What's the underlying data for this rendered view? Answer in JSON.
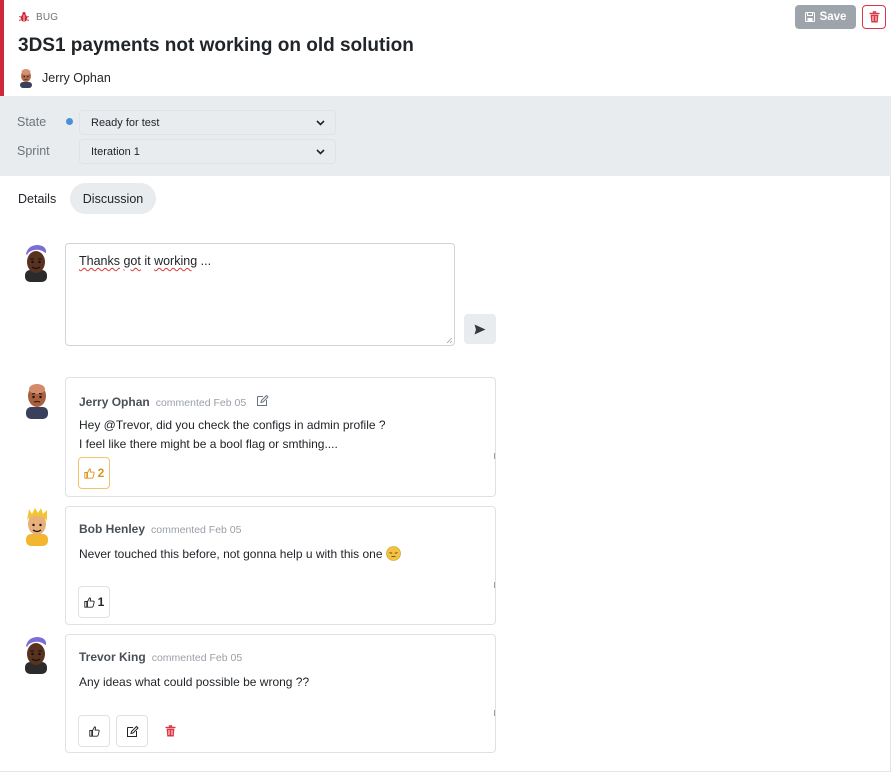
{
  "work_item": {
    "type_label": "BUG",
    "title": "3DS1 payments not working on old solution",
    "owner": "Jerry Ophan",
    "save_label": "Save"
  },
  "fields": {
    "state_label": "State",
    "state_value": "Ready for test",
    "sprint_label": "Sprint",
    "sprint_value": "Iteration 1"
  },
  "tabs": [
    {
      "label": "Details",
      "active": false
    },
    {
      "label": "Discussion",
      "active": true
    }
  ],
  "compose": {
    "text_parts": [
      "Thanks",
      " ",
      "got",
      " it ",
      "working",
      " ..."
    ]
  },
  "comments": [
    {
      "author": "Jerry Ophan",
      "meta": "commented Feb 05",
      "lines": [
        "Hey @Trevor, did you check the configs in admin profile ?",
        "I feel like there might be a bool flag or smthing...."
      ],
      "likes": "2"
    },
    {
      "author": "Bob Henley",
      "meta": "commented Feb 05",
      "lines": [
        "Never touched this before, not gonna help u with this one"
      ],
      "likes": "1"
    },
    {
      "author": "Trevor King",
      "meta": "commented Feb 05",
      "lines": [
        "Any ideas what could possible be wrong ??"
      ],
      "likes": ""
    }
  ],
  "colors": {
    "accent": "#cc293d",
    "state_dot": "#4a90d9",
    "like_active": "#d8941b",
    "delete": "#dc3545"
  },
  "icons": [
    "bug-icon",
    "save-icon",
    "trash-icon",
    "chevron-down-icon",
    "send-icon",
    "edit-icon",
    "thumbs-up-icon",
    "pensive-face-emoji"
  ]
}
